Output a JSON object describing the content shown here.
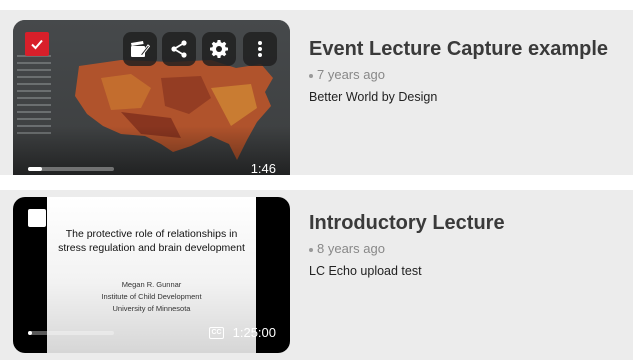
{
  "videos": [
    {
      "title": "Event Lecture Capture example",
      "age": "7 years ago",
      "description": "Better World by Design",
      "duration": "1:46",
      "selected": true,
      "progress": 0.16,
      "actions": [
        "editor-icon",
        "share-icon",
        "gear-icon",
        "more-vertical-icon"
      ]
    },
    {
      "title": "Introductory Lecture",
      "age": "8 years ago",
      "description": "LC Echo upload test",
      "duration": "1:25:00",
      "selected": false,
      "progress": 0.03,
      "has_captions": true,
      "slide": {
        "title": "The protective role of relationships in stress regulation and brain development",
        "author": "Megan R. Gunnar",
        "affiliation_1": "Institute of Child Development",
        "affiliation_2": "University of Minnesota"
      }
    }
  ],
  "colors": {
    "accent": "#d81f2a",
    "row_bg": "#ececec",
    "title_text": "#3a3a3a"
  }
}
